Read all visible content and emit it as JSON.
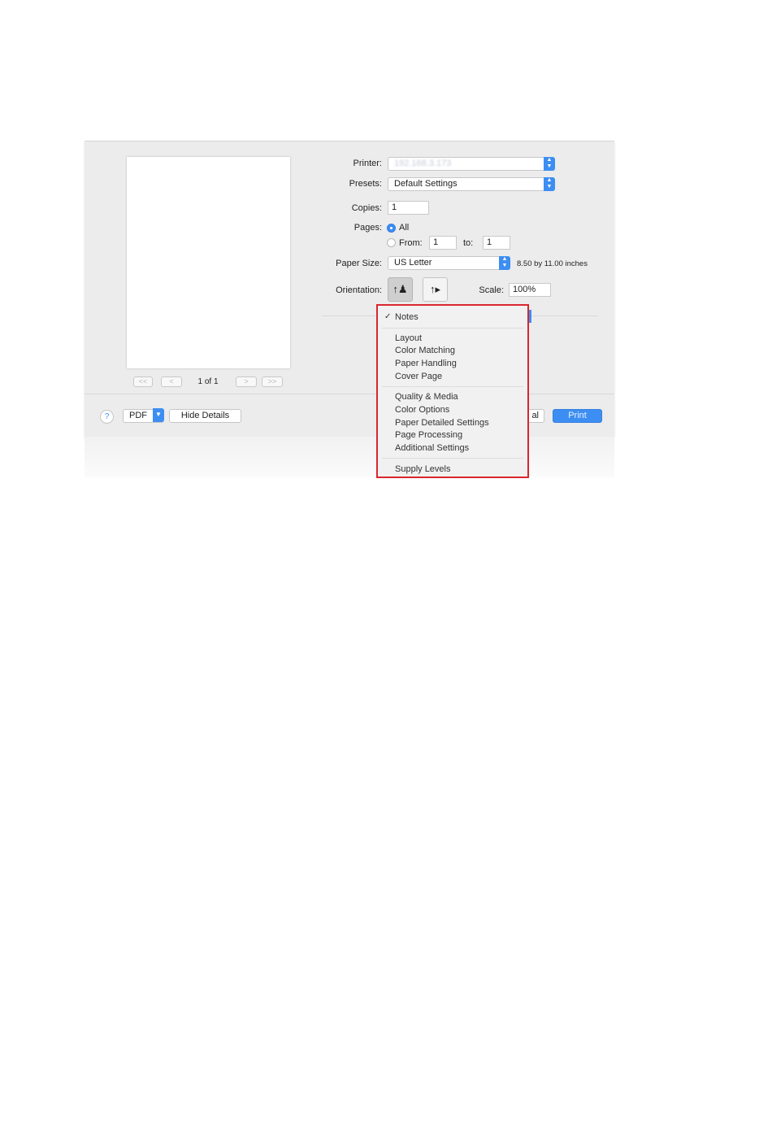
{
  "printer": {
    "label": "Printer:",
    "value": "192.168.3.173"
  },
  "presets": {
    "label": "Presets:",
    "value": "Default Settings"
  },
  "copies": {
    "label": "Copies:",
    "value": "1"
  },
  "pages": {
    "label": "Pages:",
    "all_label": "All",
    "from_label": "From:",
    "from_value": "1",
    "to_label": "to:",
    "to_value": "1"
  },
  "paper_size": {
    "label": "Paper Size:",
    "value": "US Letter",
    "dimensions": "8.50 by 11.00 inches"
  },
  "orientation": {
    "label": "Orientation:"
  },
  "scale": {
    "label": "Scale:",
    "value": "100%"
  },
  "preview": {
    "page_indicator": "1 of 1",
    "first_glyph": "<<",
    "prev_glyph": "<",
    "next_glyph": ">",
    "last_glyph": ">>"
  },
  "footer": {
    "help_glyph": "?",
    "pdf_label": "PDF",
    "hide_details_label": "Hide Details",
    "cancel_label_partial": "al",
    "print_label": "Print"
  },
  "menu": {
    "checked_item": "Notes",
    "check_glyph": "✓",
    "group1": [
      "Layout",
      "Color Matching",
      "Paper Handling",
      "Cover Page"
    ],
    "group2": [
      "Quality & Media",
      "Color Options",
      "Paper Detailed Settings",
      "Page Processing",
      "Additional Settings"
    ],
    "group3": [
      "Supply Levels"
    ]
  },
  "colors": {
    "accent": "#3d8ef2",
    "highlight_border": "#d8262e",
    "dialog_bg": "#ececec"
  }
}
